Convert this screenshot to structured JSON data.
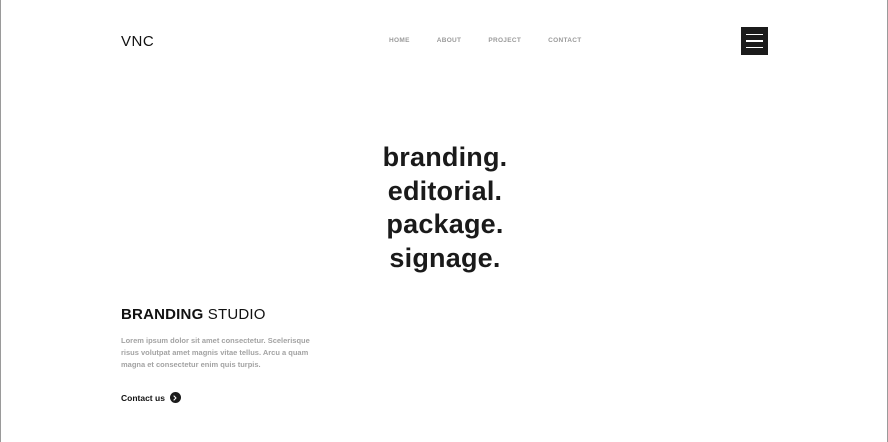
{
  "header": {
    "logo": "VNC",
    "nav": [
      {
        "label": "HOME"
      },
      {
        "label": "ABOUT"
      },
      {
        "label": "PROJECT"
      },
      {
        "label": "CONTACT"
      }
    ],
    "menu_icon": "hamburger-menu-icon"
  },
  "hero": {
    "lines": [
      "branding.",
      "editorial.",
      "package.",
      "signage."
    ]
  },
  "studio": {
    "title_bold": "BRANDING",
    "title_rest": " STUDIO",
    "description": "Lorem ipsum dolor sit amet consectetur. Scelerisque risus volutpat amet magnis vitae tellus. Arcu a quam magna et consectetur enim quis turpis.",
    "contact_label": "Contact us",
    "contact_icon": "chevron-right-icon"
  },
  "colors": {
    "text": "#111111",
    "muted": "#a3a3a3",
    "nav": "#9a9a9a",
    "menu_bg": "#1b1b1b"
  }
}
